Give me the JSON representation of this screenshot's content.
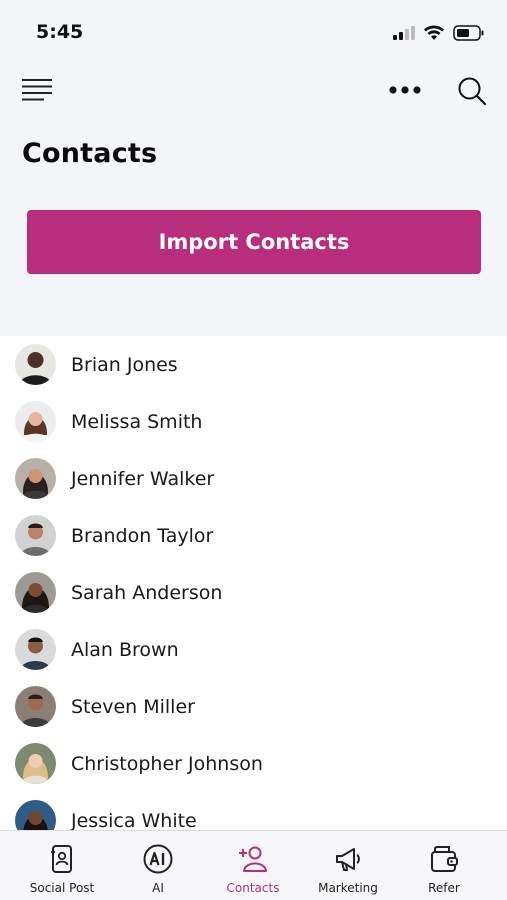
{
  "status_bar": {
    "time": "5:45"
  },
  "page": {
    "title": "Contacts"
  },
  "actions": {
    "import_label": "Import Contacts"
  },
  "contacts": [
    {
      "name": "Brian Jones"
    },
    {
      "name": "Melissa Smith"
    },
    {
      "name": "Jennifer Walker"
    },
    {
      "name": "Brandon Taylor"
    },
    {
      "name": "Sarah Anderson"
    },
    {
      "name": "Alan Brown"
    },
    {
      "name": "Steven Miller"
    },
    {
      "name": "Christopher Johnson"
    },
    {
      "name": "Jessica White"
    }
  ],
  "bottom_nav": {
    "items": [
      {
        "label": "Social Post",
        "icon": "social-post-icon"
      },
      {
        "label": "AI",
        "icon": "ai-icon"
      },
      {
        "label": "Contacts",
        "icon": "add-contact-icon",
        "active": true
      },
      {
        "label": "Marketing",
        "icon": "megaphone-icon"
      },
      {
        "label": "Refer",
        "icon": "wallet-icon"
      }
    ]
  },
  "colors": {
    "accent": "#b92d7d",
    "background_top": "#f4f5f9"
  }
}
